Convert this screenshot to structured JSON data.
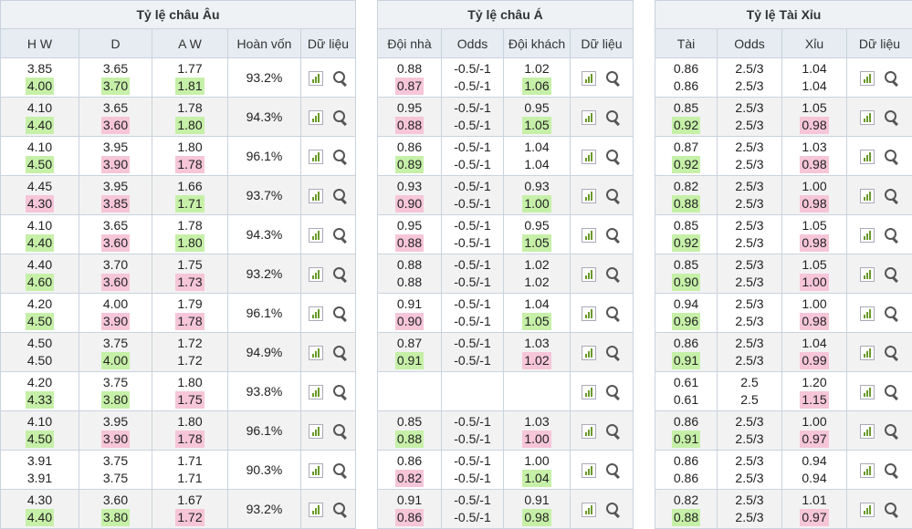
{
  "eu": {
    "title": "Tỷ lệ châu Âu",
    "headers": [
      "H W",
      "D",
      "A W",
      "Hoàn vốn",
      "Dữ liệu"
    ],
    "rows": [
      {
        "c": [
          [
            "3.85",
            "4.00",
            "up"
          ],
          [
            "3.65",
            "3.70",
            "up"
          ],
          [
            "1.77",
            "1.81",
            "up"
          ]
        ],
        "pay": "93.2%"
      },
      {
        "c": [
          [
            "4.10",
            "4.40",
            "up"
          ],
          [
            "3.65",
            "3.60",
            "down"
          ],
          [
            "1.78",
            "1.80",
            "up"
          ]
        ],
        "pay": "94.3%"
      },
      {
        "c": [
          [
            "4.10",
            "4.50",
            "up"
          ],
          [
            "3.95",
            "3.90",
            "down"
          ],
          [
            "1.80",
            "1.78",
            "down"
          ]
        ],
        "pay": "96.1%"
      },
      {
        "c": [
          [
            "4.45",
            "4.30",
            "down"
          ],
          [
            "3.95",
            "3.85",
            "down"
          ],
          [
            "1.66",
            "1.71",
            "up"
          ]
        ],
        "pay": "93.7%"
      },
      {
        "c": [
          [
            "4.10",
            "4.40",
            "up"
          ],
          [
            "3.65",
            "3.60",
            "down"
          ],
          [
            "1.78",
            "1.80",
            "up"
          ]
        ],
        "pay": "94.3%"
      },
      {
        "c": [
          [
            "4.40",
            "4.60",
            "up"
          ],
          [
            "3.70",
            "3.60",
            "down"
          ],
          [
            "1.75",
            "1.73",
            "down"
          ]
        ],
        "pay": "93.2%"
      },
      {
        "c": [
          [
            "4.20",
            "4.50",
            "up"
          ],
          [
            "4.00",
            "3.90",
            "down"
          ],
          [
            "1.79",
            "1.78",
            "down"
          ]
        ],
        "pay": "96.1%"
      },
      {
        "c": [
          [
            "4.50",
            "4.50",
            ""
          ],
          [
            "3.75",
            "4.00",
            "up"
          ],
          [
            "1.72",
            "1.72",
            ""
          ]
        ],
        "pay": "94.9%"
      },
      {
        "c": [
          [
            "4.20",
            "4.33",
            "up"
          ],
          [
            "3.75",
            "3.80",
            "up"
          ],
          [
            "1.80",
            "1.75",
            "down"
          ]
        ],
        "pay": "93.8%"
      },
      {
        "c": [
          [
            "4.10",
            "4.50",
            "up"
          ],
          [
            "3.95",
            "3.90",
            "down"
          ],
          [
            "1.80",
            "1.78",
            "down"
          ]
        ],
        "pay": "96.1%"
      },
      {
        "c": [
          [
            "3.91",
            "3.91",
            ""
          ],
          [
            "3.75",
            "3.75",
            ""
          ],
          [
            "1.71",
            "1.71",
            ""
          ]
        ],
        "pay": "90.3%"
      },
      {
        "c": [
          [
            "4.30",
            "4.40",
            "up"
          ],
          [
            "3.60",
            "3.80",
            "up"
          ],
          [
            "1.67",
            "1.72",
            "down"
          ]
        ],
        "pay": "93.2%"
      }
    ]
  },
  "asia": {
    "title": "Tỷ lệ châu Á",
    "headers": [
      "Đội nhà",
      "Odds",
      "Đội khách",
      "Dữ liệu"
    ],
    "rows": [
      {
        "c": [
          [
            "0.88",
            "0.87",
            "down"
          ],
          [
            "-0.5/-1",
            "-0.5/-1",
            ""
          ],
          [
            "1.02",
            "1.06",
            "up"
          ]
        ]
      },
      {
        "c": [
          [
            "0.95",
            "0.88",
            "down"
          ],
          [
            "-0.5/-1",
            "-0.5/-1",
            ""
          ],
          [
            "0.95",
            "1.05",
            "up"
          ]
        ]
      },
      {
        "c": [
          [
            "0.86",
            "0.89",
            "up"
          ],
          [
            "-0.5/-1",
            "-0.5/-1",
            ""
          ],
          [
            "1.04",
            "1.04",
            ""
          ]
        ]
      },
      {
        "c": [
          [
            "0.93",
            "0.90",
            "down"
          ],
          [
            "-0.5/-1",
            "-0.5/-1",
            ""
          ],
          [
            "0.93",
            "1.00",
            "up"
          ]
        ]
      },
      {
        "c": [
          [
            "0.95",
            "0.88",
            "down"
          ],
          [
            "-0.5/-1",
            "-0.5/-1",
            ""
          ],
          [
            "0.95",
            "1.05",
            "up"
          ]
        ]
      },
      {
        "c": [
          [
            "0.88",
            "0.88",
            ""
          ],
          [
            "-0.5/-1",
            "-0.5/-1",
            ""
          ],
          [
            "1.02",
            "1.02",
            ""
          ]
        ]
      },
      {
        "c": [
          [
            "0.91",
            "0.90",
            "down"
          ],
          [
            "-0.5/-1",
            "-0.5/-1",
            ""
          ],
          [
            "1.04",
            "1.05",
            "up"
          ]
        ]
      },
      {
        "c": [
          [
            "0.87",
            "0.91",
            "up"
          ],
          [
            "-0.5/-1",
            "-0.5/-1",
            ""
          ],
          [
            "1.03",
            "1.02",
            "down"
          ]
        ]
      },
      {
        "c": [
          [
            "",
            "",
            ""
          ],
          [
            "",
            "",
            ""
          ],
          [
            "",
            "",
            ""
          ]
        ],
        "empty": true
      },
      {
        "c": [
          [
            "0.85",
            "0.88",
            "up"
          ],
          [
            "-0.5/-1",
            "-0.5/-1",
            ""
          ],
          [
            "1.03",
            "1.00",
            "down"
          ]
        ]
      },
      {
        "c": [
          [
            "0.86",
            "0.82",
            "down"
          ],
          [
            "-0.5/-1",
            "-0.5/-1",
            ""
          ],
          [
            "1.00",
            "1.04",
            "up"
          ]
        ]
      },
      {
        "c": [
          [
            "0.91",
            "0.86",
            "down"
          ],
          [
            "-0.5/-1",
            "-0.5/-1",
            ""
          ],
          [
            "0.91",
            "0.98",
            "up"
          ]
        ]
      }
    ]
  },
  "ou": {
    "title": "Tỷ lệ Tài Xỉu",
    "headers": [
      "Tài",
      "Odds",
      "Xỉu",
      "Dữ liệu"
    ],
    "rows": [
      {
        "c": [
          [
            "0.86",
            "0.86",
            ""
          ],
          [
            "2.5/3",
            "2.5/3",
            ""
          ],
          [
            "1.04",
            "1.04",
            ""
          ]
        ]
      },
      {
        "c": [
          [
            "0.85",
            "0.92",
            "up"
          ],
          [
            "2.5/3",
            "2.5/3",
            ""
          ],
          [
            "1.05",
            "0.98",
            "down"
          ]
        ]
      },
      {
        "c": [
          [
            "0.87",
            "0.92",
            "up"
          ],
          [
            "2.5/3",
            "2.5/3",
            ""
          ],
          [
            "1.03",
            "0.98",
            "down"
          ]
        ]
      },
      {
        "c": [
          [
            "0.82",
            "0.88",
            "up"
          ],
          [
            "2.5/3",
            "2.5/3",
            ""
          ],
          [
            "1.00",
            "0.98",
            "down"
          ]
        ]
      },
      {
        "c": [
          [
            "0.85",
            "0.92",
            "up"
          ],
          [
            "2.5/3",
            "2.5/3",
            ""
          ],
          [
            "1.05",
            "0.98",
            "down"
          ]
        ]
      },
      {
        "c": [
          [
            "0.85",
            "0.90",
            "up"
          ],
          [
            "2.5/3",
            "2.5/3",
            ""
          ],
          [
            "1.05",
            "1.00",
            "down"
          ]
        ]
      },
      {
        "c": [
          [
            "0.94",
            "0.96",
            "up"
          ],
          [
            "2.5/3",
            "2.5/3",
            ""
          ],
          [
            "1.00",
            "0.98",
            "down"
          ]
        ]
      },
      {
        "c": [
          [
            "0.86",
            "0.91",
            "up"
          ],
          [
            "2.5/3",
            "2.5/3",
            ""
          ],
          [
            "1.04",
            "0.99",
            "down"
          ]
        ]
      },
      {
        "c": [
          [
            "0.61",
            "0.61",
            ""
          ],
          [
            "2.5",
            "2.5",
            ""
          ],
          [
            "1.20",
            "1.15",
            "down"
          ]
        ]
      },
      {
        "c": [
          [
            "0.86",
            "0.91",
            "up"
          ],
          [
            "2.5/3",
            "2.5/3",
            ""
          ],
          [
            "1.00",
            "0.97",
            "down"
          ]
        ]
      },
      {
        "c": [
          [
            "0.86",
            "0.86",
            ""
          ],
          [
            "2.5/3",
            "2.5/3",
            ""
          ],
          [
            "0.94",
            "0.94",
            ""
          ]
        ]
      },
      {
        "c": [
          [
            "0.82",
            "0.88",
            "up"
          ],
          [
            "2.5/3",
            "2.5/3",
            ""
          ],
          [
            "1.01",
            "0.97",
            "down"
          ]
        ]
      }
    ]
  },
  "icons": {
    "chart": "bar-chart-icon",
    "search": "magnifier-icon"
  },
  "colors": {
    "up": "#c6f0a8",
    "down": "#f6c6d8",
    "border": "#c9d3dd",
    "header_bg": "#e6ecf2"
  }
}
